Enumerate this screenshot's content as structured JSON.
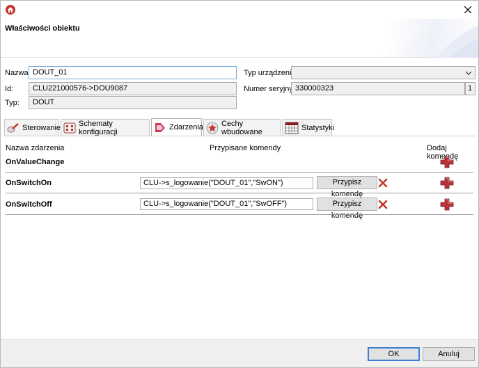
{
  "window": {
    "header_title": "Właściwości obiektu"
  },
  "properties": {
    "name_label": "Nazwa:",
    "name_value": "DOUT_01",
    "id_label": "Id:",
    "id_value": "CLU221000576->DOU9087",
    "type_label": "Typ:",
    "type_value": "DOUT",
    "device_type_label": "Typ urządzenia:",
    "device_type_value": "",
    "serial_label": "Numer seryjny:",
    "serial_value": "330000323",
    "serial_index": "1"
  },
  "tabs": [
    {
      "label": "Sterowanie",
      "active": false
    },
    {
      "label": "Schematy konfiguracji",
      "active": false
    },
    {
      "label": "Zdarzenia",
      "active": true
    },
    {
      "label": "Cechy wbudowane",
      "active": false
    },
    {
      "label": "Statystyki",
      "active": false
    }
  ],
  "events": {
    "col_event_name": "Nazwa zdarzenia",
    "col_assigned": "Przypisane komendy",
    "col_add": "Dodaj komendę",
    "rows": [
      {
        "name": "OnValueChange",
        "command": null
      },
      {
        "name": "OnSwitchOn",
        "command": "CLU->s_logowanie(\"DOUT_01\",\"SwON\")",
        "assign_label": "Przypisz komendę"
      },
      {
        "name": "OnSwitchOff",
        "command": "CLU->s_logowanie(\"DOUT_01\",\"SwOFF\")",
        "assign_label": "Przypisz komendę"
      }
    ]
  },
  "footer": {
    "ok_label": "OK",
    "cancel_label": "Anuluj"
  },
  "colors": {
    "accent": "#3c7fd0",
    "delete_red": "#c0392b",
    "add_red": "#b8323a"
  }
}
